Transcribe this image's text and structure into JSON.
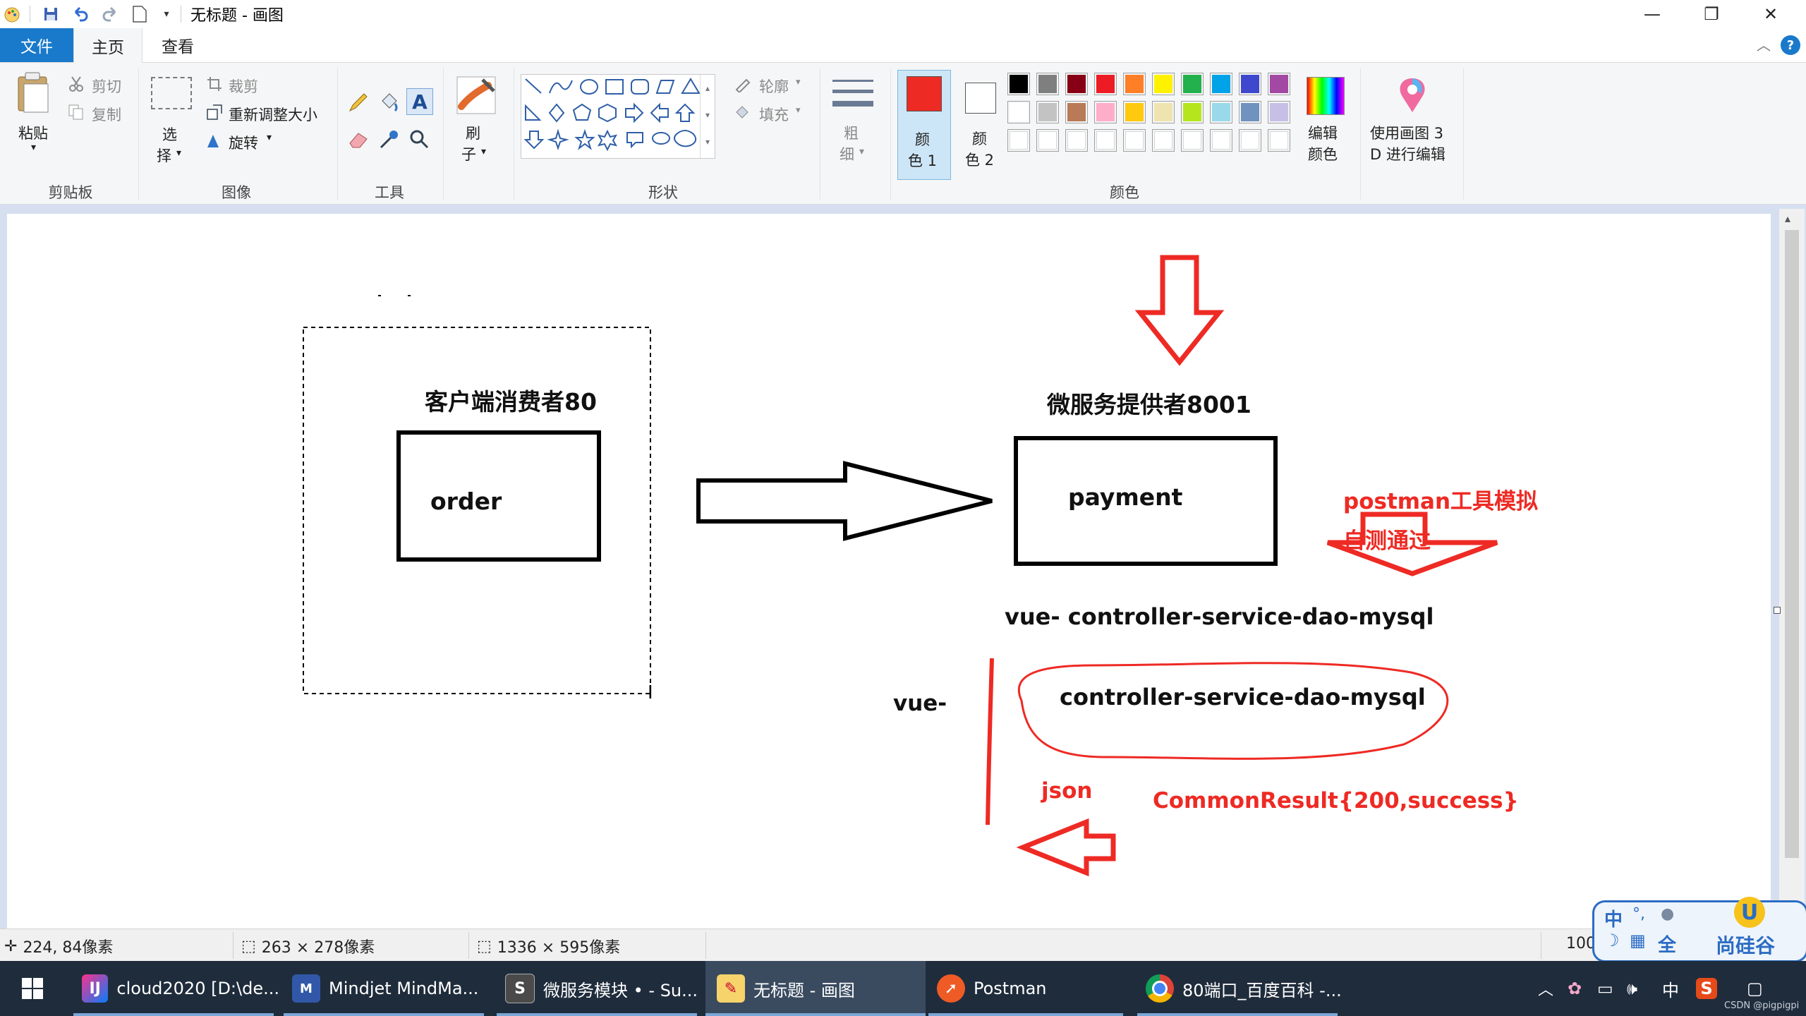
{
  "window": {
    "title": "无标题 - 画图",
    "minimize": "—",
    "maximize": "❐",
    "close": "✕"
  },
  "tabs": {
    "file": "文件",
    "home": "主页",
    "view": "查看"
  },
  "ribbon": {
    "clipboard": {
      "paste": "粘贴",
      "cut": "剪切",
      "copy": "复制",
      "label": "剪贴板"
    },
    "image": {
      "select_1": "选",
      "select_2": "择",
      "crop": "裁剪",
      "resize": "重新调整大小",
      "rotate": "旋转",
      "label": "图像"
    },
    "tools": {
      "label": "工具"
    },
    "brushes": {
      "label_1": "刷",
      "label_2": "子"
    },
    "shapes": {
      "outline": "轮廓",
      "fill": "填充",
      "label": "形状"
    },
    "size": {
      "label_1": "粗",
      "label_2": "细"
    },
    "color1": {
      "label_1": "颜",
      "label_2": "色 1",
      "value": "#ee2a24"
    },
    "color2": {
      "label_1": "颜",
      "label_2": "色 2",
      "value": "#ffffff"
    },
    "edit_colors": {
      "label_1": "编辑",
      "label_2": "颜色"
    },
    "paint3d": {
      "label_1": "使用画图 3",
      "label_2": "D 进行编辑"
    },
    "colors_label": "颜色",
    "palette_row1": [
      "#000000",
      "#7f7f7f",
      "#880015",
      "#ed1c24",
      "#ff7f27",
      "#fff200",
      "#22b14c",
      "#00a2e8",
      "#3f48cc",
      "#a349a4"
    ],
    "palette_row2": [
      "#ffffff",
      "#c3c3c3",
      "#b97a57",
      "#ffaec9",
      "#ffc90e",
      "#efe4b0",
      "#b5e61d",
      "#99d9ea",
      "#7092be",
      "#c8bfe7"
    ],
    "palette_row3": [
      "#ffffff",
      "#ffffff",
      "#ffffff",
      "#ffffff",
      "#ffffff",
      "#ffffff",
      "#ffffff",
      "#ffffff",
      "#ffffff",
      "#ffffff"
    ]
  },
  "canvas": {
    "consumer_title": "客户端消费者80",
    "order": "order",
    "provider_title": "微服务提供者8001",
    "payment": "payment",
    "postman_note_1": "postman工具模拟",
    "postman_note_2": "自测通过",
    "chain_full": "vue- controller-service-dao-mysql",
    "vue": "vue-",
    "chain": "controller-service-dao-mysql",
    "json": "json",
    "common_result": "CommonResult{200,success}"
  },
  "status": {
    "cursor_pos": "224, 84像素",
    "selection_size": "263 × 278像素",
    "image_size": "1336 × 595像素",
    "zoom": "100"
  },
  "ime": {
    "chinese": "中",
    "full": "全",
    "brand": "尚硅谷"
  },
  "taskbar": {
    "items": [
      {
        "label": "cloud2020 [D:\\de..."
      },
      {
        "label": "Mindjet MindMa..."
      },
      {
        "label": "微服务模块 • - Su..."
      },
      {
        "label": "无标题 - 画图"
      },
      {
        "label": "Postman"
      },
      {
        "label": "80端口_百度百科 -..."
      }
    ],
    "ime_indicator": "中",
    "watermark": "CSDN @pigpigpi"
  }
}
